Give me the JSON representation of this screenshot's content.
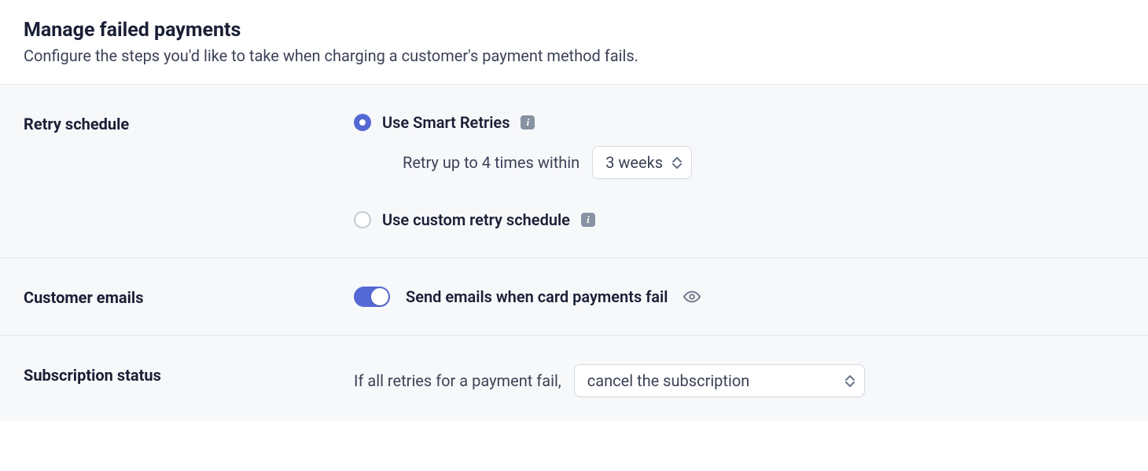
{
  "header": {
    "title": "Manage failed payments",
    "subtitle": "Configure the steps you'd like to take when charging a customer's payment method fails."
  },
  "retry": {
    "section_label": "Retry schedule",
    "smart_retries_label": "Use Smart Retries",
    "smart_retries_selected": true,
    "retry_prefix": "Retry up to 4 times within",
    "period_value": "3 weeks",
    "custom_label": "Use custom retry schedule"
  },
  "emails": {
    "section_label": "Customer emails",
    "toggle_label": "Send emails when card payments fail",
    "enabled": true
  },
  "subscription": {
    "section_label": "Subscription status",
    "prefix": "If all retries for a payment fail,",
    "action_value": "cancel the subscription"
  }
}
